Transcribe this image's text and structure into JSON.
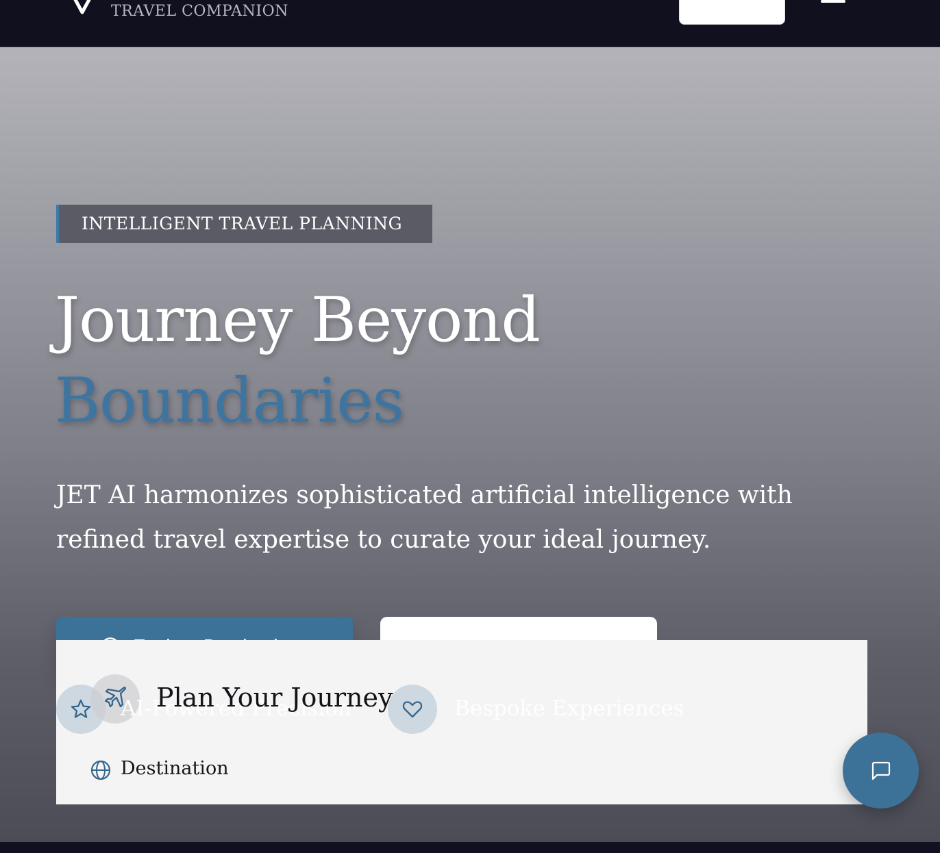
{
  "header": {
    "logo_sub": "TRAVEL COMPANION",
    "menu_icon": "hamburger-menu-icon"
  },
  "hero": {
    "tag": "INTELLIGENT TRAVEL PLANNING",
    "headline_line1": "Journey Beyond",
    "headline_accent": "Boundaries",
    "lede": "JET AI harmonizes sophisticated artificial intelligence with refined travel expertise to curate your ideal journey.",
    "primary_button": {
      "label": "Explore Destinations",
      "icon": "compass-icon"
    }
  },
  "planner": {
    "features": [
      {
        "label": "AI-Powered Precision",
        "icon": "star-icon"
      },
      {
        "label": "Bespoke Experiences",
        "icon": "heart-icon"
      }
    ],
    "title": "Plan Your Journey",
    "title_icon": "plane-icon",
    "destination_label": "Destination",
    "destination_icon": "globe-icon"
  },
  "chat": {
    "icon": "chat-bubble-icon"
  },
  "colors": {
    "accent": "#3c7198",
    "nav_bg": "#10101e",
    "card_bg": "#f4f4f5"
  }
}
